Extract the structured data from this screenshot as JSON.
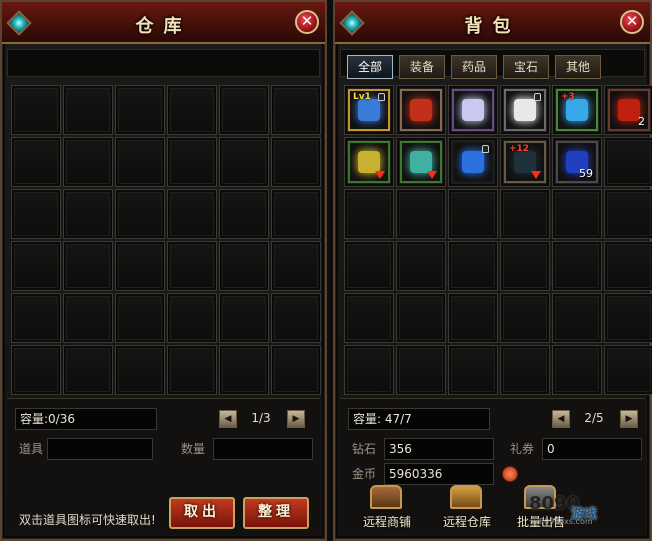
{
  "warehouse": {
    "title": "仓库",
    "grid": {
      "rows": 6,
      "cols": 6
    },
    "capacity_label": "容量:0/36",
    "page": "1/3",
    "item_label": "道具",
    "qty_label": "数量",
    "hint": "双击道具图标可快速取出!",
    "take_out_label": "取出",
    "sort_label": "整理"
  },
  "bag": {
    "title": "背包",
    "tabs": [
      {
        "label": "全部",
        "active": true
      },
      {
        "label": "装备",
        "active": false
      },
      {
        "label": "药品",
        "active": false
      },
      {
        "label": "宝石",
        "active": false
      },
      {
        "label": "其他",
        "active": false
      }
    ],
    "grid": {
      "rows": 6,
      "cols": 6
    },
    "items": [
      {
        "name": "blue-crystal",
        "color": "#3a7ad8",
        "border": "#c7962a",
        "badge": "Lv1",
        "locked": true
      },
      {
        "name": "red-pouch",
        "color": "#c0301a",
        "border": "#8a6a4a",
        "locked": false
      },
      {
        "name": "silver-wings",
        "color": "#c9c9f0",
        "border": "#6a4a8a",
        "locked": false
      },
      {
        "name": "panda-mount",
        "color": "#e8e8e8",
        "border": "#6a6a6a",
        "locked": true
      },
      {
        "name": "blue-gauntlet",
        "color": "#38a8e8",
        "border": "#4a8a2a",
        "plus": "+3",
        "locked": false
      },
      {
        "name": "red-book",
        "color": "#c02010",
        "border": "#6a3a2a",
        "count": "2",
        "locked": false
      },
      {
        "name": "gold-helmet",
        "color": "#c8b030",
        "border": "#3a7a2a",
        "arrow": true,
        "locked": false
      },
      {
        "name": "teal-shield",
        "color": "#40b0a0",
        "border": "#3a7a2a",
        "arrow": true,
        "locked": false
      },
      {
        "name": "blue-gem",
        "color": "#2a70e0",
        "border": "#1a1a1a",
        "locked": true
      },
      {
        "name": "dark-boots",
        "color": "#20303a",
        "border": "#6a5a40",
        "plus": "+12",
        "arrow": true,
        "locked": false
      },
      {
        "name": "blue-potion",
        "color": "#2040c0",
        "border": "#4a4a4a",
        "count": "59",
        "locked": false
      }
    ],
    "capacity_label": "容量: 47/7",
    "page": "2/5",
    "diamond_label": "钻石",
    "diamond_value": "356",
    "coupon_label": "礼券",
    "coupon_value": "0",
    "gold_label": "金币",
    "gold_value": "5960336",
    "buttons": [
      {
        "label": "远程商铺"
      },
      {
        "label": "远程仓库"
      },
      {
        "label": "批量出售"
      }
    ],
    "watermark_number": "8090",
    "watermark_text": "游戏",
    "watermark_url": "8090yxs.com"
  }
}
